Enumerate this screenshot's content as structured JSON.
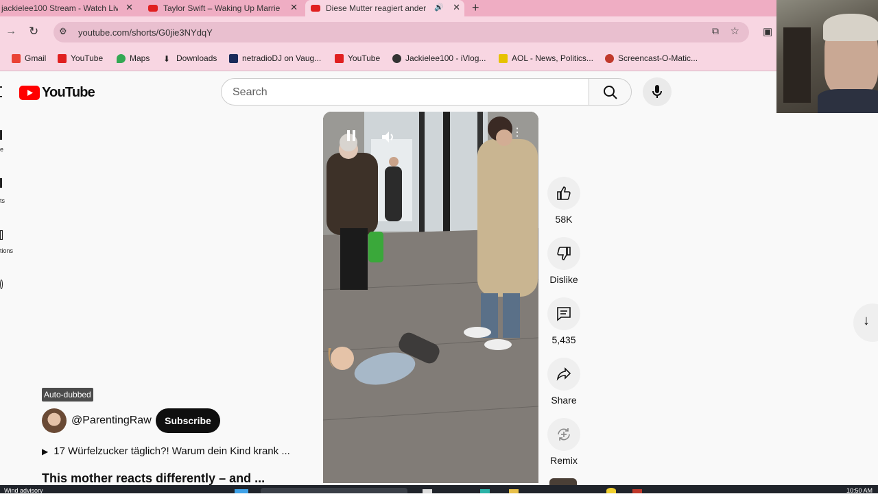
{
  "browser": {
    "tabs": [
      {
        "title": "jackielee100 Stream - Watch Liv"
      },
      {
        "title": "Taylor Swift – Waking Up Marrie"
      },
      {
        "title": "Diese Mutter reagiert ander"
      }
    ],
    "new_tab": "+",
    "url": "youtube.com/shorts/G0jie3NYdqY",
    "bookmarks": [
      {
        "label": "Gmail",
        "color": "#ea4335"
      },
      {
        "label": "YouTube",
        "color": "#e02020"
      },
      {
        "label": "Maps",
        "color": "#34a853"
      },
      {
        "label": "Downloads",
        "color": "#333333"
      },
      {
        "label": "netradioDJ on Vaug...",
        "color": "#1a2a5a"
      },
      {
        "label": "YouTube",
        "color": "#e02020"
      },
      {
        "label": "Jackielee100 - iVlog...",
        "color": "#333333"
      },
      {
        "label": "AOL - News, Politics...",
        "color": "#e6c200"
      },
      {
        "label": "Screencast-O-Matic...",
        "color": "#c0392b"
      }
    ]
  },
  "youtube": {
    "logo_text": "YouTube",
    "search_placeholder": "Search",
    "sidebar_fragments": [
      "e",
      "ts",
      "tions"
    ],
    "video": {
      "auto_dubbed": "Auto-dubbed"
    },
    "channel": {
      "handle": "@ParentingRaw",
      "subscribe": "Subscribe"
    },
    "related_title": "17 Würfelzucker täglich?! Warum dein Kind krank ...",
    "title": "This mother reacts differently – and ...",
    "actions": {
      "likes": "58K",
      "dislike": "Dislike",
      "comments": "5,435",
      "share": "Share",
      "remix": "Remix"
    }
  },
  "taskbar": {
    "weather": "Wind advisory",
    "time": "10:50 AM"
  }
}
